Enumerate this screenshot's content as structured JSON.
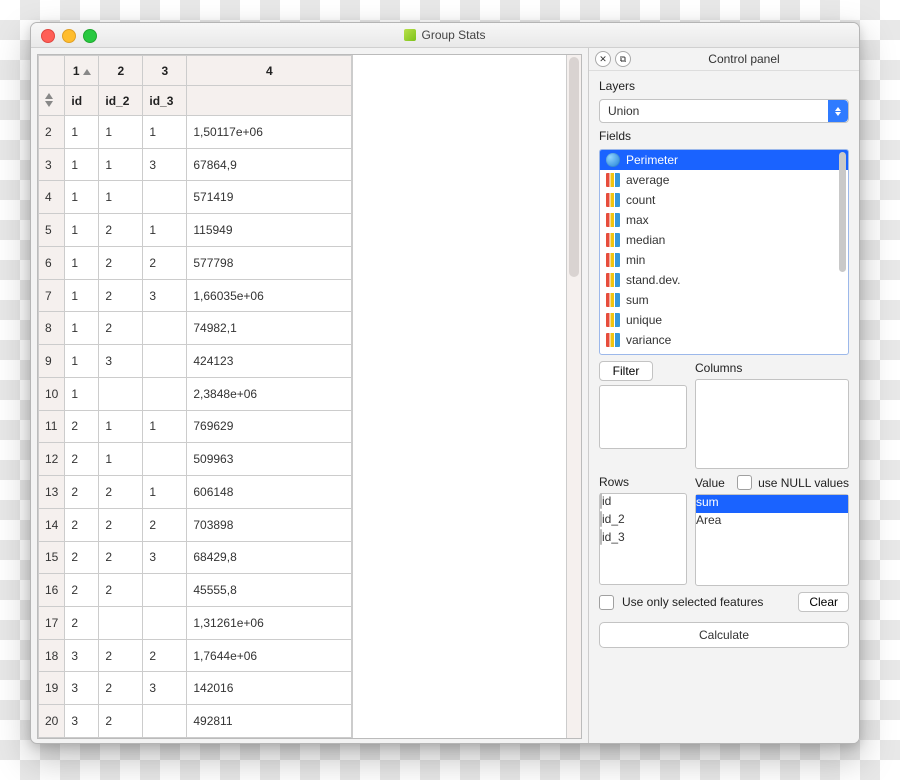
{
  "window": {
    "title": "Group Stats"
  },
  "table": {
    "column_numbers": [
      "1",
      "2",
      "3",
      "4"
    ],
    "column_labels": [
      "id",
      "id_2",
      "id_3",
      ""
    ],
    "rows": [
      {
        "n": "2",
        "c1": "1",
        "c2": "1",
        "c3": "1",
        "c4": "1,50117e+06"
      },
      {
        "n": "3",
        "c1": "1",
        "c2": "1",
        "c3": "3",
        "c4": "67864,9"
      },
      {
        "n": "4",
        "c1": "1",
        "c2": "1",
        "c3": "",
        "c4": "571419"
      },
      {
        "n": "5",
        "c1": "1",
        "c2": "2",
        "c3": "1",
        "c4": "115949"
      },
      {
        "n": "6",
        "c1": "1",
        "c2": "2",
        "c3": "2",
        "c4": "577798"
      },
      {
        "n": "7",
        "c1": "1",
        "c2": "2",
        "c3": "3",
        "c4": "1,66035e+06"
      },
      {
        "n": "8",
        "c1": "1",
        "c2": "2",
        "c3": "",
        "c4": "74982,1"
      },
      {
        "n": "9",
        "c1": "1",
        "c2": "3",
        "c3": "",
        "c4": "424123"
      },
      {
        "n": "10",
        "c1": "1",
        "c2": "",
        "c3": "",
        "c4": "2,3848e+06"
      },
      {
        "n": "11",
        "c1": "2",
        "c2": "1",
        "c3": "1",
        "c4": "769629"
      },
      {
        "n": "12",
        "c1": "2",
        "c2": "1",
        "c3": "",
        "c4": "509963"
      },
      {
        "n": "13",
        "c1": "2",
        "c2": "2",
        "c3": "1",
        "c4": "606148"
      },
      {
        "n": "14",
        "c1": "2",
        "c2": "2",
        "c3": "2",
        "c4": "703898"
      },
      {
        "n": "15",
        "c1": "2",
        "c2": "2",
        "c3": "3",
        "c4": "68429,8"
      },
      {
        "n": "16",
        "c1": "2",
        "c2": "2",
        "c3": "",
        "c4": "45555,8"
      },
      {
        "n": "17",
        "c1": "2",
        "c2": "",
        "c3": "",
        "c4": "1,31261e+06"
      },
      {
        "n": "18",
        "c1": "3",
        "c2": "2",
        "c3": "2",
        "c4": "1,7644e+06"
      },
      {
        "n": "19",
        "c1": "3",
        "c2": "2",
        "c3": "3",
        "c4": "142016"
      },
      {
        "n": "20",
        "c1": "3",
        "c2": "2",
        "c3": "",
        "c4": "492811"
      }
    ]
  },
  "panel": {
    "title": "Control panel",
    "layers_label": "Layers",
    "layer_selected": "Union",
    "fields_label": "Fields",
    "fields": [
      "Perimeter",
      "average",
      "count",
      "max",
      "median",
      "min",
      "stand.dev.",
      "sum",
      "unique",
      "variance"
    ],
    "fields_selected_index": 0,
    "filter_label": "Filter",
    "columns_label": "Columns",
    "rows_label": "Rows",
    "rows_items": [
      "id",
      "id_2",
      "id_3"
    ],
    "value_label": "Value",
    "use_null_label": "use NULL values",
    "value_items": [
      "sum",
      "Area"
    ],
    "value_selected_index": 0,
    "use_only_selected_label": "Use only selected features",
    "clear_label": "Clear",
    "calculate_label": "Calculate"
  }
}
